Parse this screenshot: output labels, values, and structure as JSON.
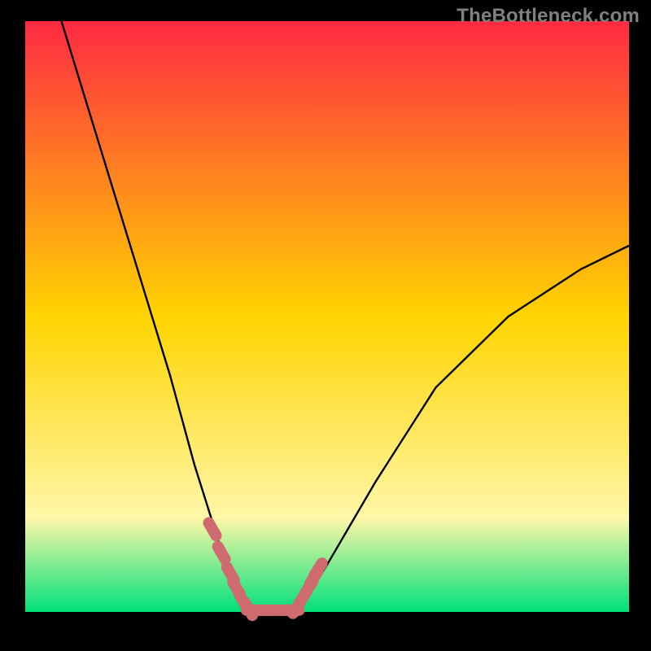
{
  "watermark": "TheBottleneck.com",
  "colors": {
    "black": "#000000",
    "grad_top": "#ff2a42",
    "grad_mid": "#ffd400",
    "grad_cream": "#fff7a8",
    "grad_green": "#00e07a",
    "curve": "#000000",
    "marker": "#cf6b6f"
  },
  "chart_data": {
    "type": "line",
    "title": "",
    "xlabel": "",
    "ylabel": "",
    "xlim": [
      0,
      100
    ],
    "ylim": [
      0,
      100
    ],
    "left_branch": [
      {
        "x": 6,
        "y": 100
      },
      {
        "x": 12,
        "y": 80
      },
      {
        "x": 18,
        "y": 60
      },
      {
        "x": 24,
        "y": 40
      },
      {
        "x": 28,
        "y": 25
      },
      {
        "x": 32,
        "y": 12
      },
      {
        "x": 35,
        "y": 4
      },
      {
        "x": 37,
        "y": 0
      }
    ],
    "right_branch": [
      {
        "x": 45,
        "y": 0
      },
      {
        "x": 50,
        "y": 8
      },
      {
        "x": 58,
        "y": 22
      },
      {
        "x": 68,
        "y": 38
      },
      {
        "x": 80,
        "y": 50
      },
      {
        "x": 92,
        "y": 58
      },
      {
        "x": 100,
        "y": 62
      }
    ],
    "floor": {
      "x_start": 37,
      "x_end": 45,
      "y": 0
    },
    "markers_left": [
      {
        "x": 31,
        "y": 14
      },
      {
        "x": 32.5,
        "y": 10
      },
      {
        "x": 34,
        "y": 6.5
      },
      {
        "x": 35,
        "y": 4
      },
      {
        "x": 36,
        "y": 2
      },
      {
        "x": 37,
        "y": 0.5
      }
    ],
    "markers_floor": [
      {
        "x": 38,
        "y": 0.3
      },
      {
        "x": 40,
        "y": 0.3
      },
      {
        "x": 42,
        "y": 0.3
      },
      {
        "x": 44,
        "y": 0.3
      }
    ],
    "markers_right": [
      {
        "x": 45,
        "y": 0.8
      },
      {
        "x": 46,
        "y": 2.5
      },
      {
        "x": 47,
        "y": 4.2
      },
      {
        "x": 47.8,
        "y": 5.8
      },
      {
        "x": 48.5,
        "y": 7.2
      }
    ]
  }
}
